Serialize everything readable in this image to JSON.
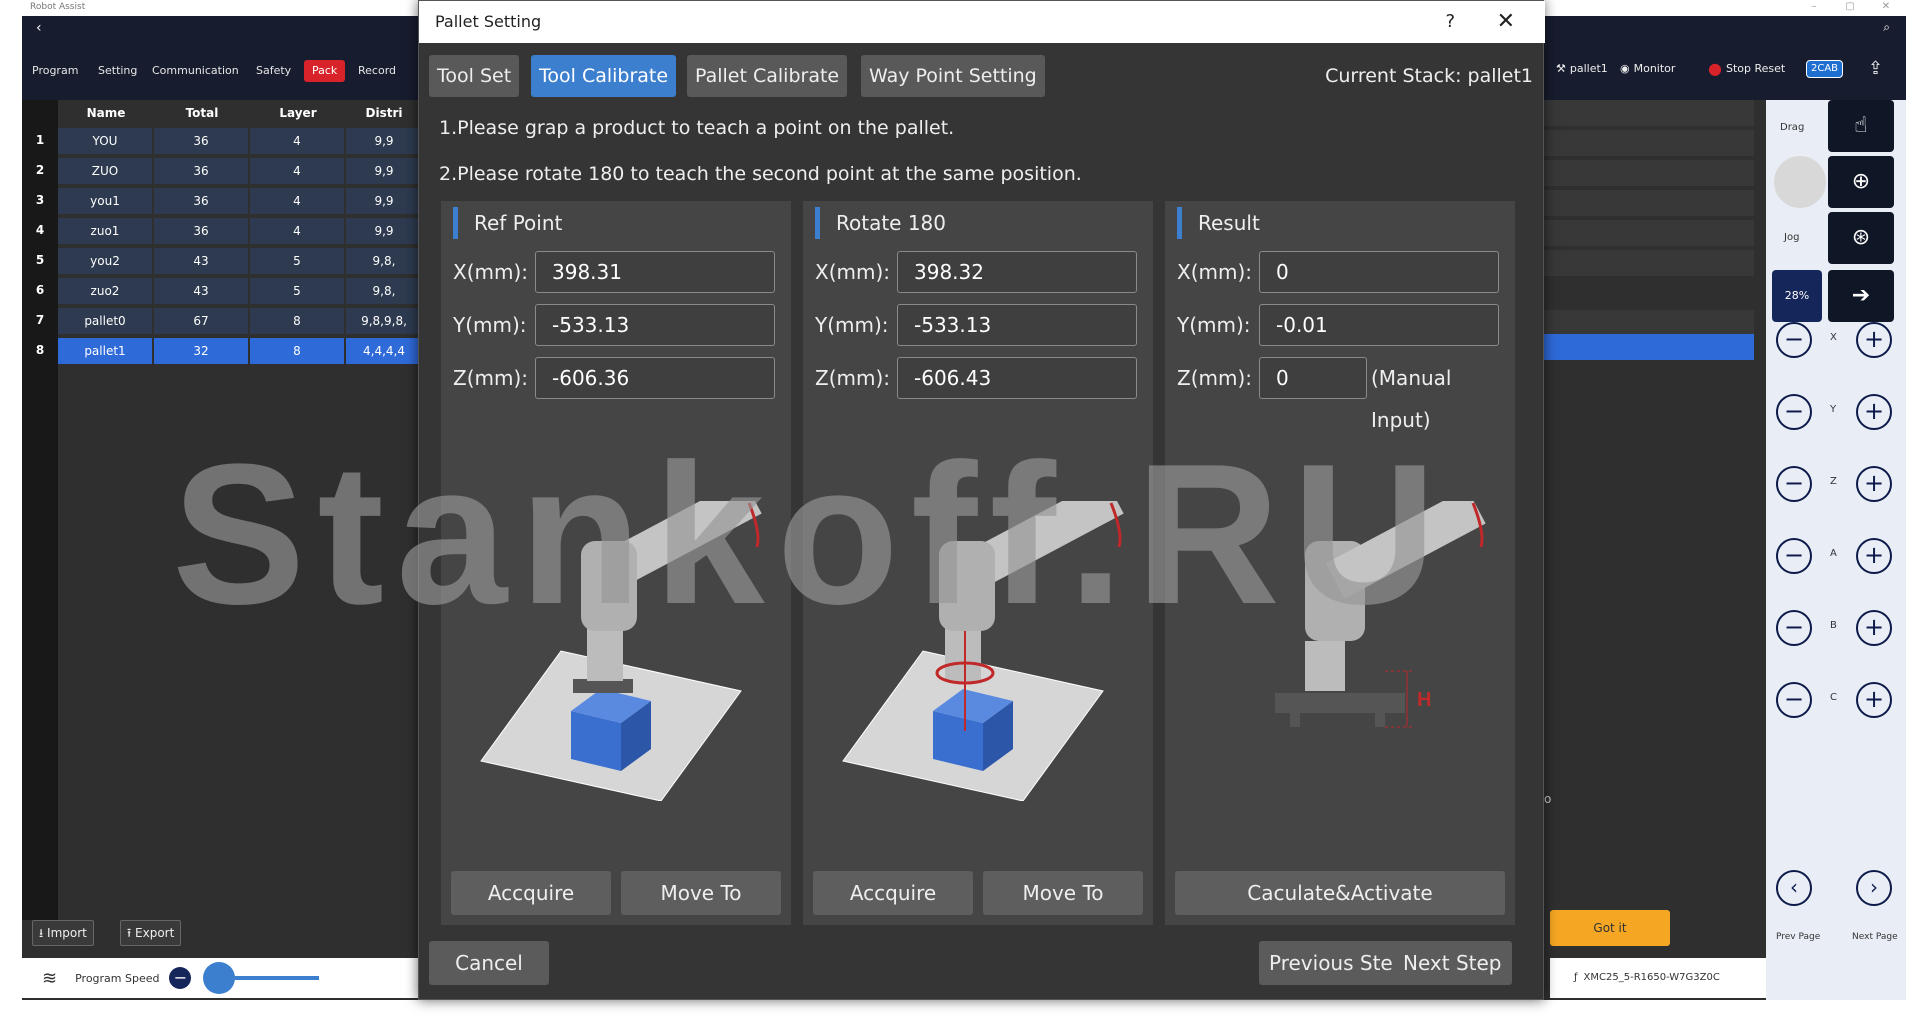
{
  "app": {
    "title": "Robot Assist",
    "nav": [
      "Program",
      "Setting",
      "Communication",
      "Safety",
      "Pack",
      "Record"
    ],
    "active_nav": "Pack",
    "right_items": {
      "pallet": "pallet1",
      "monitor": "Monitor",
      "stop_reset": "Stop Reset",
      "badge": "2CAB"
    }
  },
  "table": {
    "headers": [
      "Name",
      "Total",
      "Layer",
      "Distri"
    ],
    "rows": [
      {
        "num": "1",
        "name": "YOU",
        "total": "36",
        "layer": "4",
        "distri": "9,9"
      },
      {
        "num": "2",
        "name": "ZUO",
        "total": "36",
        "layer": "4",
        "distri": "9,9"
      },
      {
        "num": "3",
        "name": "you1",
        "total": "36",
        "layer": "4",
        "distri": "9,9"
      },
      {
        "num": "4",
        "name": "zuo1",
        "total": "36",
        "layer": "4",
        "distri": "9,9"
      },
      {
        "num": "5",
        "name": "you2",
        "total": "43",
        "layer": "5",
        "distri": "9,8,"
      },
      {
        "num": "6",
        "name": "zuo2",
        "total": "43",
        "layer": "5",
        "distri": "9,8,"
      },
      {
        "num": "7",
        "name": "pallet0",
        "total": "67",
        "layer": "8",
        "distri": "9,8,9,8,"
      },
      {
        "num": "8",
        "name": "pallet1",
        "total": "32",
        "layer": "8",
        "distri": "4,4,4,4"
      }
    ],
    "selected_row": "8"
  },
  "bottom": {
    "import": "Import",
    "export": "Export",
    "program_speed": "Program Speed"
  },
  "right_strip": {
    "got_it": "Got it",
    "device": "XMC25_5-R1650-W7G3Z0C",
    "stray": "o"
  },
  "side_panel": {
    "drag": "Drag",
    "jog": "Jog",
    "speed": "28%",
    "axes": [
      "X",
      "Y",
      "Z",
      "A",
      "B",
      "C"
    ],
    "prev_page": "Prev Page",
    "next_page": "Next Page"
  },
  "dialog": {
    "title": "Pallet Setting",
    "help": "?",
    "tabs": [
      "Tool Set",
      "Tool Calibrate",
      "Pallet Calibrate",
      "Way Point Setting"
    ],
    "active_tab": "Tool Calibrate",
    "current_stack": "Current Stack: pallet1",
    "step1": "1.Please grap a product to teach a point on the pallet.",
    "step2": "2.Please rotate 180 to teach the second point at the same position.",
    "panels": [
      {
        "title": "Ref Point",
        "x_label": "X(mm):",
        "y_label": "Y(mm):",
        "z_label": "Z(mm):",
        "x": "398.31",
        "y": "-533.13",
        "z": "-606.36",
        "btn1": "Accquire",
        "btn2": "Move To"
      },
      {
        "title": "Rotate 180",
        "x_label": "X(mm):",
        "y_label": "Y(mm):",
        "z_label": "Z(mm):",
        "x": "398.32",
        "y": "-533.13",
        "z": "-606.43",
        "btn1": "Accquire",
        "btn2": "Move To"
      },
      {
        "title": "Result",
        "x_label": "X(mm):",
        "y_label": "Y(mm):",
        "z_label": "Z(mm):",
        "x": "0",
        "y": "-0.01",
        "z": "0",
        "manual": "(Manual Input)",
        "btn": "Caculate&Activate",
        "h_label": "H"
      }
    ],
    "cancel": "Cancel",
    "previous": "Previous Step",
    "next": "Next Step"
  },
  "watermark": "Stankoff.RU",
  "colors": {
    "accent": "#3d7fcf",
    "pack_active": "#d9232a",
    "topbar": "#171c2e",
    "got_it": "#f5a623"
  }
}
